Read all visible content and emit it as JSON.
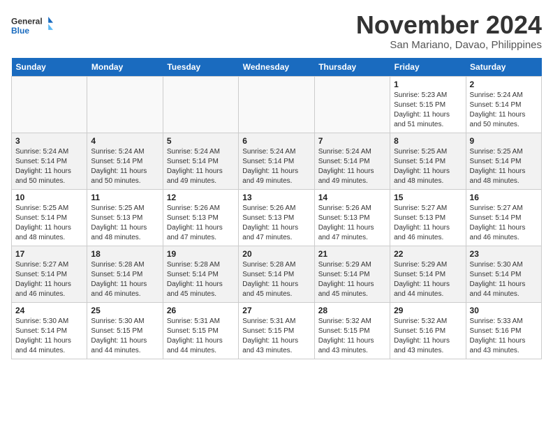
{
  "logo": {
    "line1": "General",
    "line2": "Blue"
  },
  "title": "November 2024",
  "subtitle": "San Mariano, Davao, Philippines",
  "days_of_week": [
    "Sunday",
    "Monday",
    "Tuesday",
    "Wednesday",
    "Thursday",
    "Friday",
    "Saturday"
  ],
  "weeks": [
    [
      {
        "day": "",
        "info": ""
      },
      {
        "day": "",
        "info": ""
      },
      {
        "day": "",
        "info": ""
      },
      {
        "day": "",
        "info": ""
      },
      {
        "day": "",
        "info": ""
      },
      {
        "day": "1",
        "info": "Sunrise: 5:23 AM\nSunset: 5:15 PM\nDaylight: 11 hours and 51 minutes."
      },
      {
        "day": "2",
        "info": "Sunrise: 5:24 AM\nSunset: 5:14 PM\nDaylight: 11 hours and 50 minutes."
      }
    ],
    [
      {
        "day": "3",
        "info": "Sunrise: 5:24 AM\nSunset: 5:14 PM\nDaylight: 11 hours and 50 minutes."
      },
      {
        "day": "4",
        "info": "Sunrise: 5:24 AM\nSunset: 5:14 PM\nDaylight: 11 hours and 50 minutes."
      },
      {
        "day": "5",
        "info": "Sunrise: 5:24 AM\nSunset: 5:14 PM\nDaylight: 11 hours and 49 minutes."
      },
      {
        "day": "6",
        "info": "Sunrise: 5:24 AM\nSunset: 5:14 PM\nDaylight: 11 hours and 49 minutes."
      },
      {
        "day": "7",
        "info": "Sunrise: 5:24 AM\nSunset: 5:14 PM\nDaylight: 11 hours and 49 minutes."
      },
      {
        "day": "8",
        "info": "Sunrise: 5:25 AM\nSunset: 5:14 PM\nDaylight: 11 hours and 48 minutes."
      },
      {
        "day": "9",
        "info": "Sunrise: 5:25 AM\nSunset: 5:14 PM\nDaylight: 11 hours and 48 minutes."
      }
    ],
    [
      {
        "day": "10",
        "info": "Sunrise: 5:25 AM\nSunset: 5:14 PM\nDaylight: 11 hours and 48 minutes."
      },
      {
        "day": "11",
        "info": "Sunrise: 5:25 AM\nSunset: 5:13 PM\nDaylight: 11 hours and 48 minutes."
      },
      {
        "day": "12",
        "info": "Sunrise: 5:26 AM\nSunset: 5:13 PM\nDaylight: 11 hours and 47 minutes."
      },
      {
        "day": "13",
        "info": "Sunrise: 5:26 AM\nSunset: 5:13 PM\nDaylight: 11 hours and 47 minutes."
      },
      {
        "day": "14",
        "info": "Sunrise: 5:26 AM\nSunset: 5:13 PM\nDaylight: 11 hours and 47 minutes."
      },
      {
        "day": "15",
        "info": "Sunrise: 5:27 AM\nSunset: 5:13 PM\nDaylight: 11 hours and 46 minutes."
      },
      {
        "day": "16",
        "info": "Sunrise: 5:27 AM\nSunset: 5:14 PM\nDaylight: 11 hours and 46 minutes."
      }
    ],
    [
      {
        "day": "17",
        "info": "Sunrise: 5:27 AM\nSunset: 5:14 PM\nDaylight: 11 hours and 46 minutes."
      },
      {
        "day": "18",
        "info": "Sunrise: 5:28 AM\nSunset: 5:14 PM\nDaylight: 11 hours and 46 minutes."
      },
      {
        "day": "19",
        "info": "Sunrise: 5:28 AM\nSunset: 5:14 PM\nDaylight: 11 hours and 45 minutes."
      },
      {
        "day": "20",
        "info": "Sunrise: 5:28 AM\nSunset: 5:14 PM\nDaylight: 11 hours and 45 minutes."
      },
      {
        "day": "21",
        "info": "Sunrise: 5:29 AM\nSunset: 5:14 PM\nDaylight: 11 hours and 45 minutes."
      },
      {
        "day": "22",
        "info": "Sunrise: 5:29 AM\nSunset: 5:14 PM\nDaylight: 11 hours and 44 minutes."
      },
      {
        "day": "23",
        "info": "Sunrise: 5:30 AM\nSunset: 5:14 PM\nDaylight: 11 hours and 44 minutes."
      }
    ],
    [
      {
        "day": "24",
        "info": "Sunrise: 5:30 AM\nSunset: 5:14 PM\nDaylight: 11 hours and 44 minutes."
      },
      {
        "day": "25",
        "info": "Sunrise: 5:30 AM\nSunset: 5:15 PM\nDaylight: 11 hours and 44 minutes."
      },
      {
        "day": "26",
        "info": "Sunrise: 5:31 AM\nSunset: 5:15 PM\nDaylight: 11 hours and 44 minutes."
      },
      {
        "day": "27",
        "info": "Sunrise: 5:31 AM\nSunset: 5:15 PM\nDaylight: 11 hours and 43 minutes."
      },
      {
        "day": "28",
        "info": "Sunrise: 5:32 AM\nSunset: 5:15 PM\nDaylight: 11 hours and 43 minutes."
      },
      {
        "day": "29",
        "info": "Sunrise: 5:32 AM\nSunset: 5:16 PM\nDaylight: 11 hours and 43 minutes."
      },
      {
        "day": "30",
        "info": "Sunrise: 5:33 AM\nSunset: 5:16 PM\nDaylight: 11 hours and 43 minutes."
      }
    ]
  ]
}
